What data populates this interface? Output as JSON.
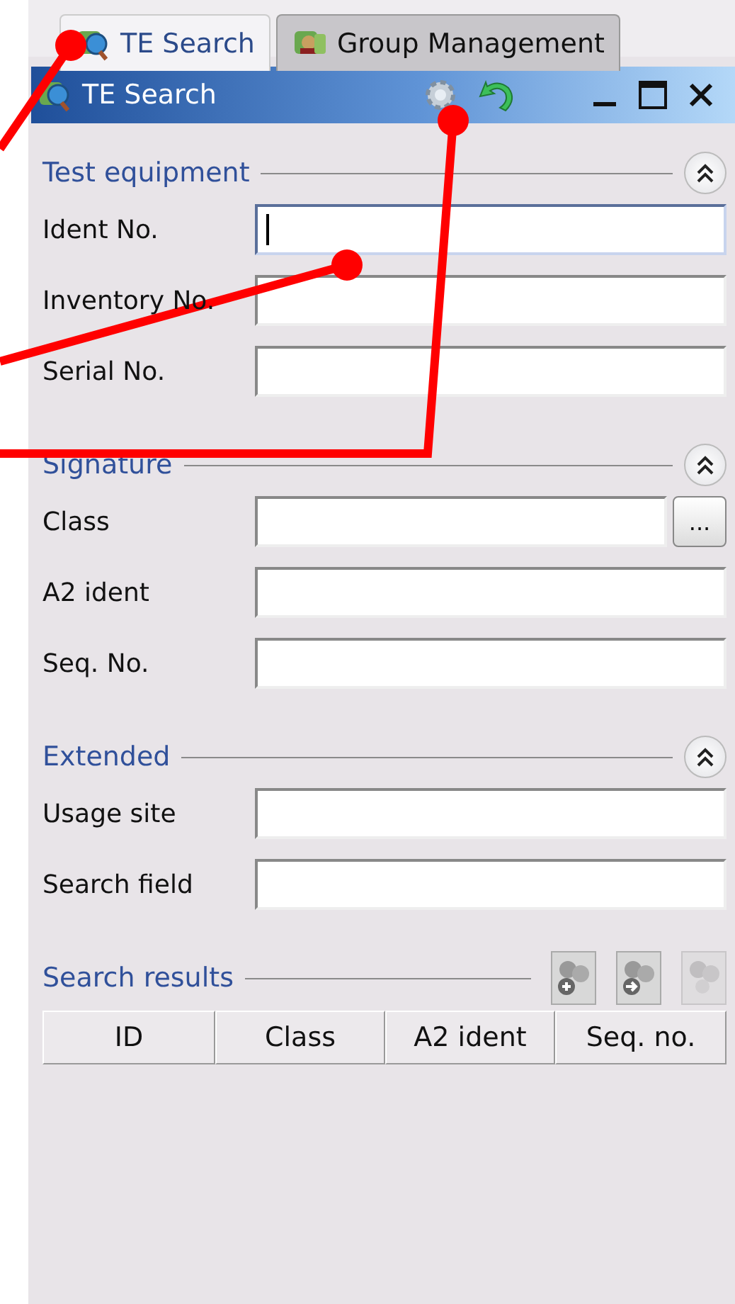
{
  "tabs": [
    {
      "label": "TE Search",
      "selected": true
    },
    {
      "label": "Group Management",
      "selected": false
    }
  ],
  "view": {
    "title": "TE Search"
  },
  "sections": [
    {
      "title": "Test equipment",
      "expanded": true,
      "fields": [
        {
          "label": "Ident No.",
          "focused": true
        },
        {
          "label": "Inventory No.",
          "focused": false
        },
        {
          "label": "Serial No.",
          "focused": false
        }
      ]
    },
    {
      "title": "Signature",
      "expanded": true,
      "fields": [
        {
          "label": "Class",
          "focused": false,
          "browse": "..."
        },
        {
          "label": "A2 ident",
          "focused": false
        },
        {
          "label": "Seq. No.",
          "focused": false
        }
      ]
    },
    {
      "title": "Extended",
      "expanded": true,
      "fields": [
        {
          "label": "Usage site",
          "focused": false
        },
        {
          "label": "Search field",
          "focused": false
        }
      ]
    }
  ],
  "results": {
    "title": "Search results",
    "tools": [
      {
        "kind": "add",
        "disabled": false
      },
      {
        "kind": "go",
        "disabled": false
      },
      {
        "kind": "plain",
        "disabled": true
      }
    ],
    "columns": [
      "ID",
      "Class",
      "A2 ident",
      "Seq. no."
    ]
  }
}
